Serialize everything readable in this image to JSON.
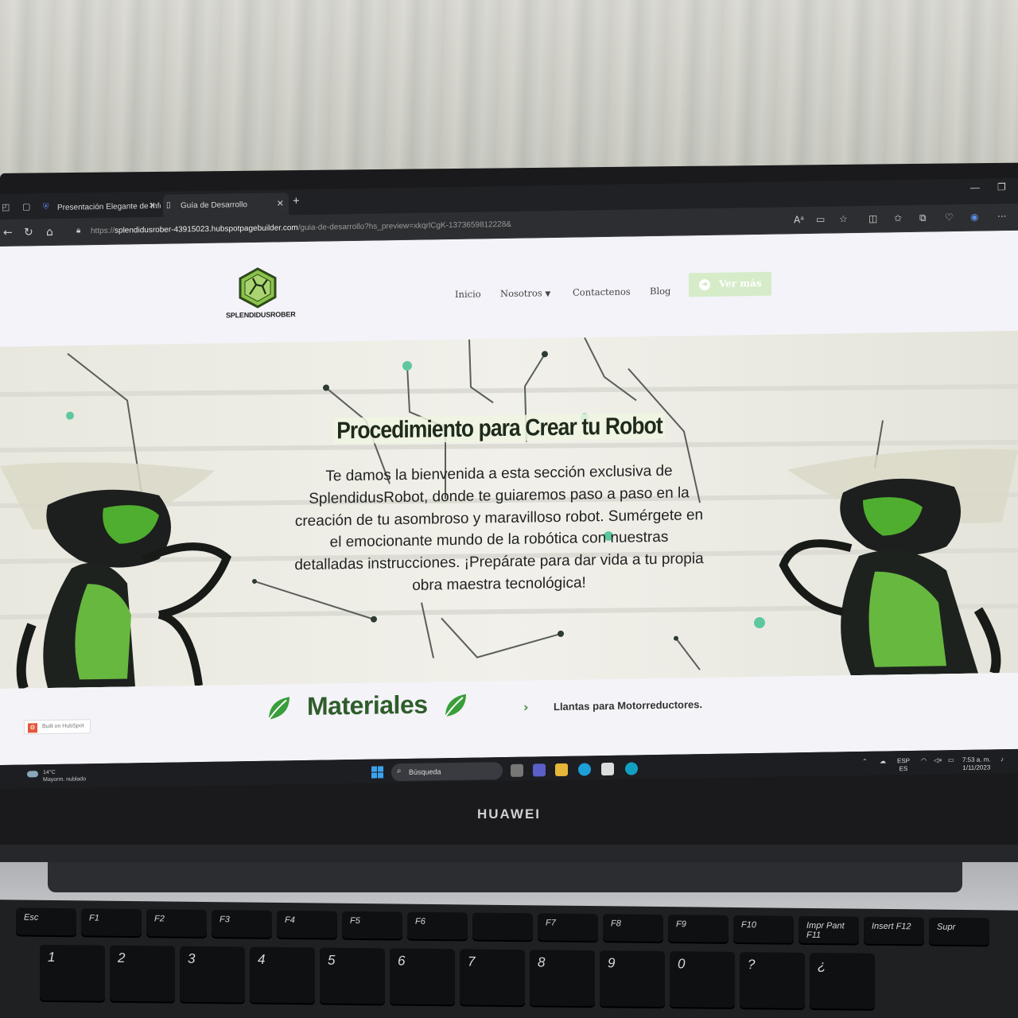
{
  "browser": {
    "tabs": [
      {
        "title": "Presentación Elegante de Inform",
        "active": false
      },
      {
        "title": "Guía de Desarrollo",
        "active": true
      }
    ],
    "url_prefix": "https://",
    "url_host": "splendidusrober-43915023.hubspotpagebuilder.com",
    "url_path": "/guia-de-desarrollo?hs_preview=xkqrlCgK-1373659812228&"
  },
  "site": {
    "logo_text": "SPLENDIDUSROBER",
    "nav": [
      {
        "label": "Inicio"
      },
      {
        "label": "Nosotros"
      },
      {
        "label": "Contactenos"
      },
      {
        "label": "Blog"
      }
    ],
    "cta_label": "Ver más",
    "accent": "#2f5d2a",
    "cta_color": "#d6ecc9"
  },
  "hero": {
    "title": "Procedimiento para Crear tu Robot",
    "text": "Te damos la bienvenida a esta sección exclusiva de SplendidusRobot, donde te guiaremos paso a paso en la creación de tu asombroso y maravilloso robot. Sumérgete en el emocionante mundo de la robótica con nuestras detalladas instrucciones. ¡Prepárate para dar vida a tu propia obra maestra tecnológica!"
  },
  "materials": {
    "title": "Materiales",
    "first_item": "Llantas para Motorreductores."
  },
  "hubspot_badge": "Built on HubSpot",
  "taskbar": {
    "temperature": "14°C",
    "weather": "Mayorm. nublado",
    "search_label": "Búsqueda",
    "lang_top": "ESP",
    "lang_bottom": "ES",
    "time": "7:53 a. m.",
    "date": "1/11/2023"
  },
  "laptop": {
    "brand": "HUAWEI",
    "keys_row1": [
      "Esc",
      "F1",
      "F2",
      "F3",
      "F4",
      "F5",
      "F6",
      "",
      "F7",
      "F8",
      "F9",
      "F10",
      "Impr Pant F11",
      "Insert F12",
      "Supr"
    ],
    "keys_row2": [
      "1",
      "2",
      "3",
      "4",
      "5",
      "6",
      "7",
      "8",
      "9",
      "0",
      "?",
      "¿"
    ]
  }
}
